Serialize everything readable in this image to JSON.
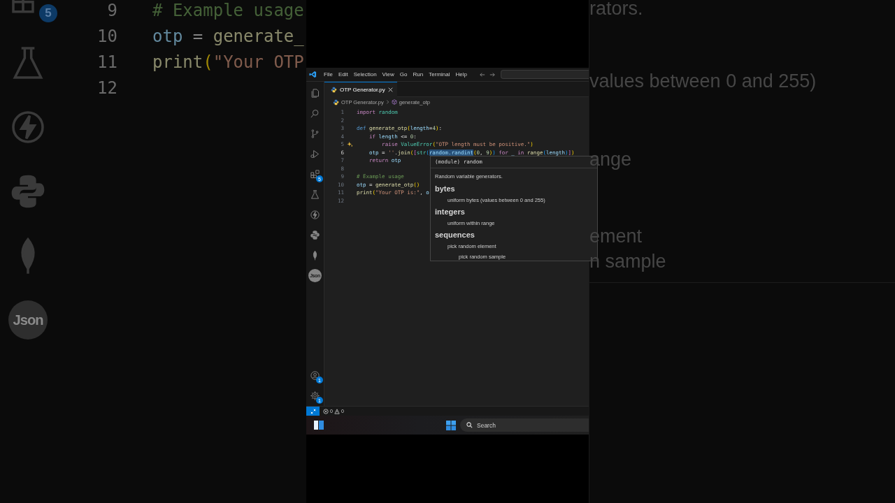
{
  "backdrop": {
    "icons": [
      {
        "kind": "extensions",
        "badge": "5"
      },
      {
        "kind": "flask"
      },
      {
        "kind": "bolt"
      },
      {
        "kind": "python"
      },
      {
        "kind": "leaf"
      },
      {
        "kind": "json",
        "label": "Json"
      }
    ],
    "code_lines": [
      {
        "number": "9",
        "tokens": [
          {
            "kind": "comment",
            "text": "# Example usage"
          }
        ]
      },
      {
        "number": "10",
        "tokens": [
          {
            "kind": "var",
            "text": "otp"
          },
          {
            "kind": "plain",
            "text": " = "
          },
          {
            "kind": "fn",
            "text": "generate_"
          }
        ]
      },
      {
        "number": "11",
        "tokens": [
          {
            "kind": "fn",
            "text": "print"
          },
          {
            "kind": "b1",
            "text": "("
          },
          {
            "kind": "str",
            "text": "\"Your OTP"
          }
        ]
      },
      {
        "number": "12"
      }
    ],
    "fragments": [
      "rators.",
      "values between 0 and 255)",
      "ange",
      "ement",
      "n sample"
    ]
  },
  "menu": [
    "File",
    "Edit",
    "Selection",
    "View",
    "Go",
    "Run",
    "Terminal",
    "Help"
  ],
  "tab": {
    "label": "OTP Generator.py"
  },
  "breadcrumb": {
    "file": "OTP Generator.py",
    "symbol": "generate_otp"
  },
  "activity_bar": {
    "top": [
      {
        "kind": "files"
      },
      {
        "kind": "search"
      },
      {
        "kind": "branch"
      },
      {
        "kind": "run"
      },
      {
        "kind": "extensions",
        "badge": "5"
      },
      {
        "kind": "flask"
      },
      {
        "kind": "bolt"
      },
      {
        "kind": "python"
      },
      {
        "kind": "leaf"
      },
      {
        "kind": "json",
        "label": "Json"
      }
    ],
    "bottom": [
      {
        "kind": "account",
        "badge": "1"
      },
      {
        "kind": "gear",
        "badge": "1"
      }
    ]
  },
  "code_lines": [
    {
      "number": "1",
      "current": false,
      "sparkle": false,
      "tokens": [
        {
          "kind": "kw",
          "text": "import"
        },
        {
          "kind": "module",
          "text": " random"
        }
      ]
    },
    {
      "number": "2",
      "current": false,
      "sparkle": false
    },
    {
      "number": "3",
      "current": false,
      "sparkle": false,
      "tokens": [
        {
          "kind": "def",
          "text": "def"
        },
        {
          "kind": "fn",
          "text": " generate_otp"
        },
        {
          "kind": "b1",
          "text": "("
        },
        {
          "kind": "var",
          "text": "length"
        },
        {
          "kind": "plain",
          "text": "="
        },
        {
          "kind": "num",
          "text": "4"
        },
        {
          "kind": "b1",
          "text": ")"
        },
        {
          "kind": "plain",
          "text": ":"
        }
      ]
    },
    {
      "number": "4",
      "current": false,
      "sparkle": false,
      "tokens": [
        {
          "kind": "kw",
          "text": "    if"
        },
        {
          "kind": "var",
          "text": " length"
        },
        {
          "kind": "plain",
          "text": " <= "
        },
        {
          "kind": "num",
          "text": "0"
        },
        {
          "kind": "plain",
          "text": ":"
        }
      ]
    },
    {
      "number": "5",
      "current": false,
      "sparkle": true,
      "tokens": [
        {
          "kind": "kw",
          "text": "        raise"
        },
        {
          "kind": "cls",
          "text": " ValueError"
        },
        {
          "kind": "b1",
          "text": "("
        },
        {
          "kind": "str",
          "text": "\"OTP length must be positive.\""
        },
        {
          "kind": "b1",
          "text": ")"
        }
      ]
    },
    {
      "number": "6",
      "current": true,
      "sparkle": false,
      "tokens": [
        {
          "kind": "var",
          "text": "    otp"
        },
        {
          "kind": "plain",
          "text": " = "
        },
        {
          "kind": "str",
          "text": "''"
        },
        {
          "kind": "plain",
          "text": "."
        },
        {
          "kind": "fn",
          "text": "join"
        },
        {
          "kind": "b1",
          "text": "("
        },
        {
          "kind": "b2",
          "text": "["
        },
        {
          "kind": "cls",
          "text": "str"
        },
        {
          "kind": "b3",
          "text": "("
        },
        {
          "kind": "selection",
          "text": "random.randint"
        },
        {
          "kind": "b1",
          "text": "("
        },
        {
          "kind": "num",
          "text": "0"
        },
        {
          "kind": "plain",
          "text": ", "
        },
        {
          "kind": "num",
          "text": "9"
        },
        {
          "kind": "b1",
          "text": ")"
        },
        {
          "kind": "b3",
          "text": ")"
        },
        {
          "kind": "kw",
          "text": " for"
        },
        {
          "kind": "var",
          "text": " _"
        },
        {
          "kind": "kw",
          "text": " in"
        },
        {
          "kind": "fn",
          "text": " range"
        },
        {
          "kind": "b3",
          "text": "("
        },
        {
          "kind": "var",
          "text": "length"
        },
        {
          "kind": "b3",
          "text": ")"
        },
        {
          "kind": "b2",
          "text": "]"
        },
        {
          "kind": "b1",
          "text": ")"
        }
      ]
    },
    {
      "number": "7",
      "current": false,
      "sparkle": false,
      "tokens": [
        {
          "kind": "kw",
          "text": "    return"
        },
        {
          "kind": "var",
          "text": " otp"
        }
      ]
    },
    {
      "number": "8",
      "current": false,
      "sparkle": false
    },
    {
      "number": "9",
      "current": false,
      "sparkle": false,
      "tokens": [
        {
          "kind": "comment",
          "text": "# Example usage"
        }
      ]
    },
    {
      "number": "10",
      "current": false,
      "sparkle": false,
      "tokens": [
        {
          "kind": "var",
          "text": "otp"
        },
        {
          "kind": "plain",
          "text": " = "
        },
        {
          "kind": "fn",
          "text": "generate_otp"
        },
        {
          "kind": "b1",
          "text": "()"
        }
      ]
    },
    {
      "number": "11",
      "current": false,
      "sparkle": false,
      "tokens": [
        {
          "kind": "fn",
          "text": "print"
        },
        {
          "kind": "b1",
          "text": "("
        },
        {
          "kind": "str",
          "text": "\"Your OTP is:\""
        },
        {
          "kind": "plain",
          "text": ", "
        },
        {
          "kind": "var",
          "text": "o"
        }
      ]
    },
    {
      "number": "12",
      "current": false,
      "sparkle": false
    }
  ],
  "hover": {
    "signature": "(module) random",
    "description": "Random variable generators.",
    "sections": [
      {
        "heading": "bytes",
        "items": [
          {
            "text": "uniform bytes (values between 0 and 255)"
          }
        ]
      },
      {
        "heading": "integers",
        "items": [
          {
            "text": "uniform within range"
          }
        ]
      },
      {
        "heading": "sequences",
        "items": [
          {
            "text": "pick random element",
            "children": [
              {
                "text": "pick random sample"
              }
            ]
          }
        ]
      }
    ]
  },
  "status_bar": {
    "errors": "0",
    "warnings": "0"
  },
  "taskbar": {
    "search_placeholder": "Search"
  }
}
